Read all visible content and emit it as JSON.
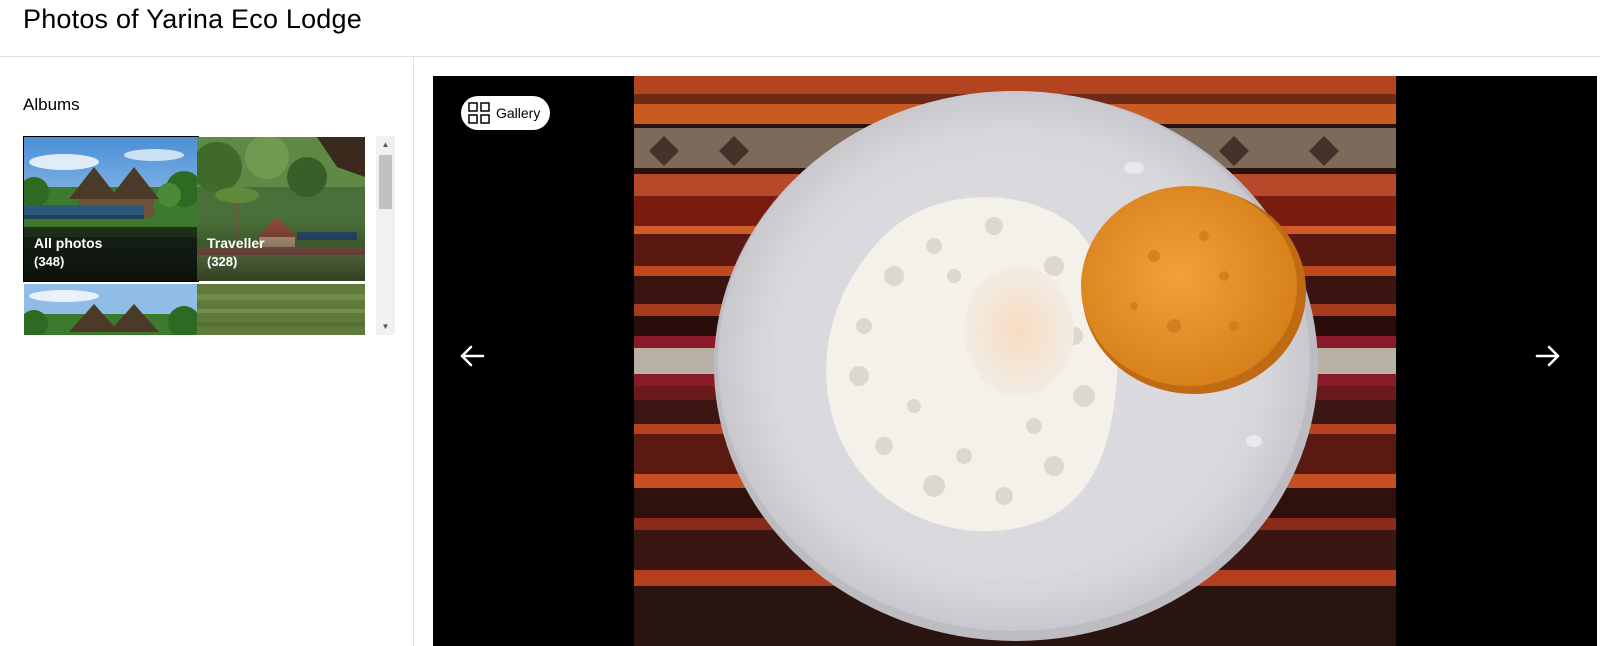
{
  "page": {
    "title": "Photos of Yarina Eco Lodge"
  },
  "sidebar": {
    "heading": "Albums",
    "albums": [
      {
        "label": "All photos",
        "count": "(348)",
        "selected": true
      },
      {
        "label": "Traveller",
        "count": "(328)",
        "selected": false
      },
      {
        "label": "",
        "count": "",
        "selected": false
      },
      {
        "label": "",
        "count": "",
        "selected": false
      }
    ],
    "scrollbar": {
      "up_icon": "triangle-up",
      "down_icon": "triangle-down"
    }
  },
  "viewer": {
    "gallery_label": "Gallery",
    "gallery_icon": "grid-icon",
    "prev_icon": "arrow-left-icon",
    "next_icon": "arrow-right-icon",
    "photo_subject": "plate with fried egg and arepa"
  },
  "colors": {
    "viewer_bg": "#000000",
    "divider": "#e0e0e0",
    "scroll_thumb": "#c1c1c1"
  }
}
